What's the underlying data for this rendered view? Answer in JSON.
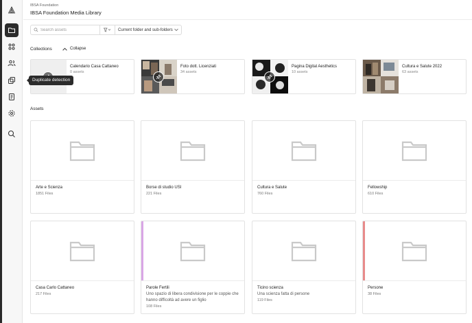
{
  "header": {
    "org": "IBSA Foundation",
    "title": "IBSA Foundation Media Library"
  },
  "sidebar": {
    "items": [
      {
        "name": "folder-icon",
        "active": true
      },
      {
        "name": "apps-icon",
        "active": false
      },
      {
        "name": "users-icon",
        "active": false
      },
      {
        "name": "duplicate-icon",
        "active": false
      },
      {
        "name": "document-icon",
        "active": false
      },
      {
        "name": "gear-icon",
        "active": false
      },
      {
        "name": "search-icon",
        "active": false
      }
    ],
    "tooltip": "Duplicate detection"
  },
  "toolbar": {
    "search_placeholder": "Search assets",
    "scope_label": "Current folder and sub-folders"
  },
  "collections": {
    "title": "Collections",
    "collapse_label": "Collapse",
    "items": [
      {
        "name": "Calendario Casa Cattaneo",
        "count": "0 assets"
      },
      {
        "name": "Foto dott. Licenziati",
        "count": "34 assets"
      },
      {
        "name": "Pagina Digital Aesthetics",
        "count": "10 assets"
      },
      {
        "name": "Cultura e Salute 2022",
        "count": "63 assets"
      }
    ]
  },
  "assets": {
    "title": "Assets",
    "items": [
      {
        "name": "Arte e Scienza",
        "desc": "",
        "count": "1851 Files",
        "stripe": ""
      },
      {
        "name": "Borse di studio USI",
        "desc": "",
        "count": "221 Files",
        "stripe": ""
      },
      {
        "name": "Cultura e Salute",
        "desc": "",
        "count": "760 Files",
        "stripe": ""
      },
      {
        "name": "Fellowship",
        "desc": "",
        "count": "610 Files",
        "stripe": ""
      },
      {
        "name": "Casa Carlo Cattaneo",
        "desc": "",
        "count": "217 Files",
        "stripe": ""
      },
      {
        "name": "Parole Fertili",
        "desc": "Uno spazio di libera condivisione per le coppie che hanno difficoltà ad avere un figlio",
        "count": "108 Files",
        "stripe": "#d9a6e6"
      },
      {
        "name": "Ticino scienza",
        "desc": "Una scienza fatta di persone",
        "count": "119 Files",
        "stripe": ""
      },
      {
        "name": "Persone",
        "desc": "",
        "count": "38 Files",
        "stripe": "#e88a8a"
      }
    ]
  },
  "colors": {
    "sidebar_active": "#2b2b2b",
    "folder_icon": "#c9c9c9"
  }
}
